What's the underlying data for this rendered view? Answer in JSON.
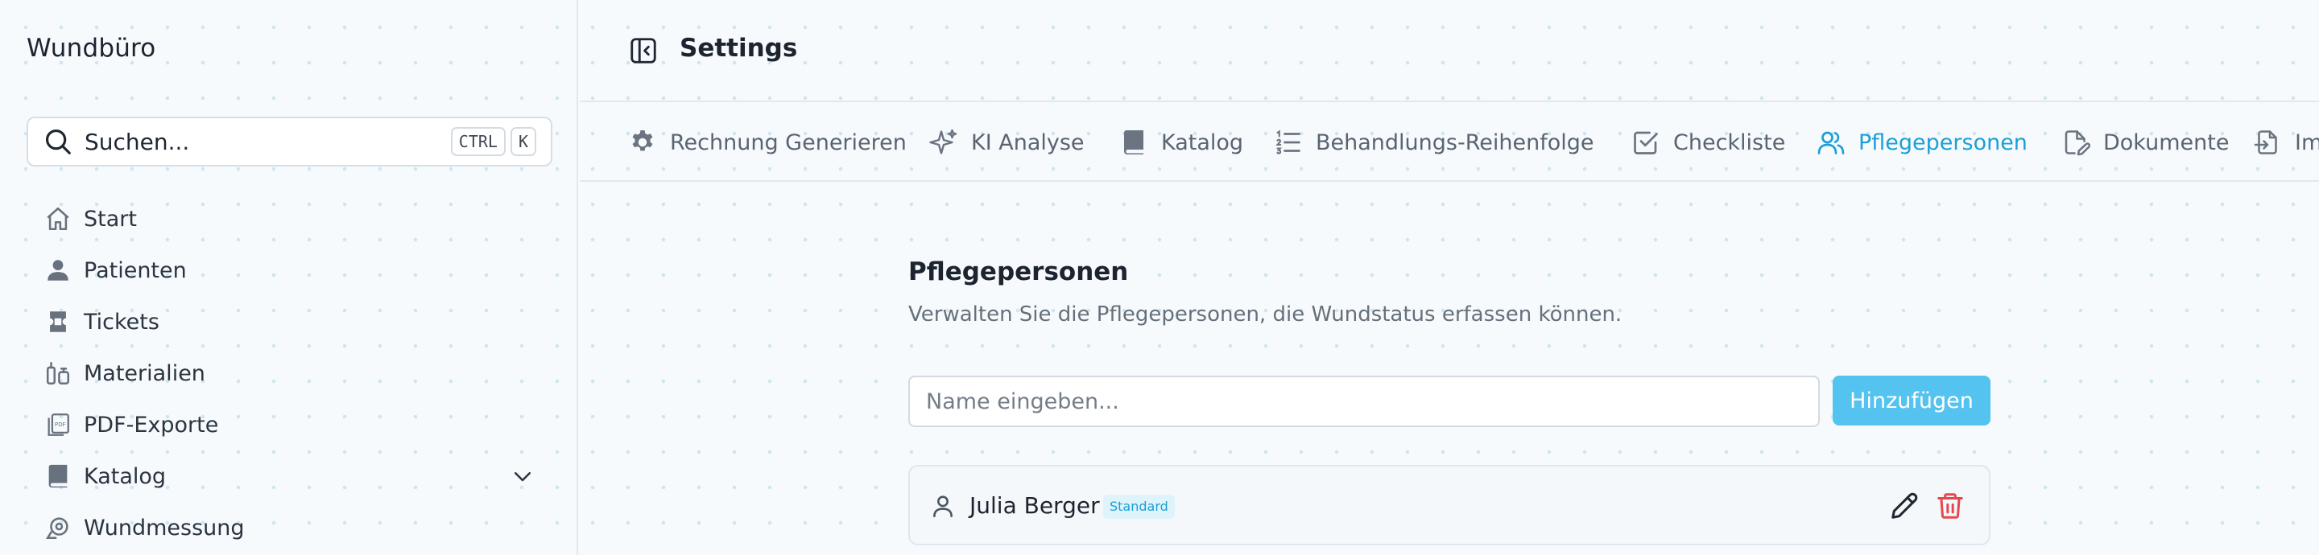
{
  "sidebar": {
    "brand": "Wundbüro",
    "search": {
      "label": "Suchen...",
      "shortcut_keys": [
        "CTRL",
        "K"
      ]
    },
    "items": [
      {
        "label": "Start",
        "icon": "home-icon"
      },
      {
        "label": "Patienten",
        "icon": "user-icon"
      },
      {
        "label": "Tickets",
        "icon": "ticket-icon"
      },
      {
        "label": "Materialien",
        "icon": "materials-icon"
      },
      {
        "label": "PDF-Exporte",
        "icon": "pdf-icon"
      },
      {
        "label": "Katalog",
        "icon": "book-icon",
        "expandable": true
      },
      {
        "label": "Wundmessung",
        "icon": "measure-icon"
      }
    ]
  },
  "header": {
    "title": "Settings"
  },
  "tabs": [
    {
      "label": "Rechnung Generieren",
      "icon": "gear-icon"
    },
    {
      "label": "KI Analyse",
      "icon": "sparkle-icon"
    },
    {
      "label": "Katalog",
      "icon": "book-icon"
    },
    {
      "label": "Behandlungs-Reihenfolge",
      "icon": "ordered-list-icon"
    },
    {
      "label": "Checkliste",
      "icon": "checkbox-icon"
    },
    {
      "label": "Pflegepersonen",
      "icon": "users-icon",
      "active": true
    },
    {
      "label": "Dokumente",
      "icon": "document-edit-icon"
    },
    {
      "label": "Im",
      "icon": "import-icon"
    }
  ],
  "section": {
    "title": "Pflegepersonen",
    "subtitle": "Verwalten Sie die Pflegepersonen, die Wundstatus erfassen können.",
    "input_placeholder": "Name eingeben...",
    "input_value": "",
    "add_label": "Hinzufügen"
  },
  "caregivers": [
    {
      "name": "Julia Berger",
      "badge": "Standard"
    }
  ],
  "colors": {
    "accent": "#1d9fd6",
    "button": "#54c3ef",
    "danger": "#e5484d"
  }
}
